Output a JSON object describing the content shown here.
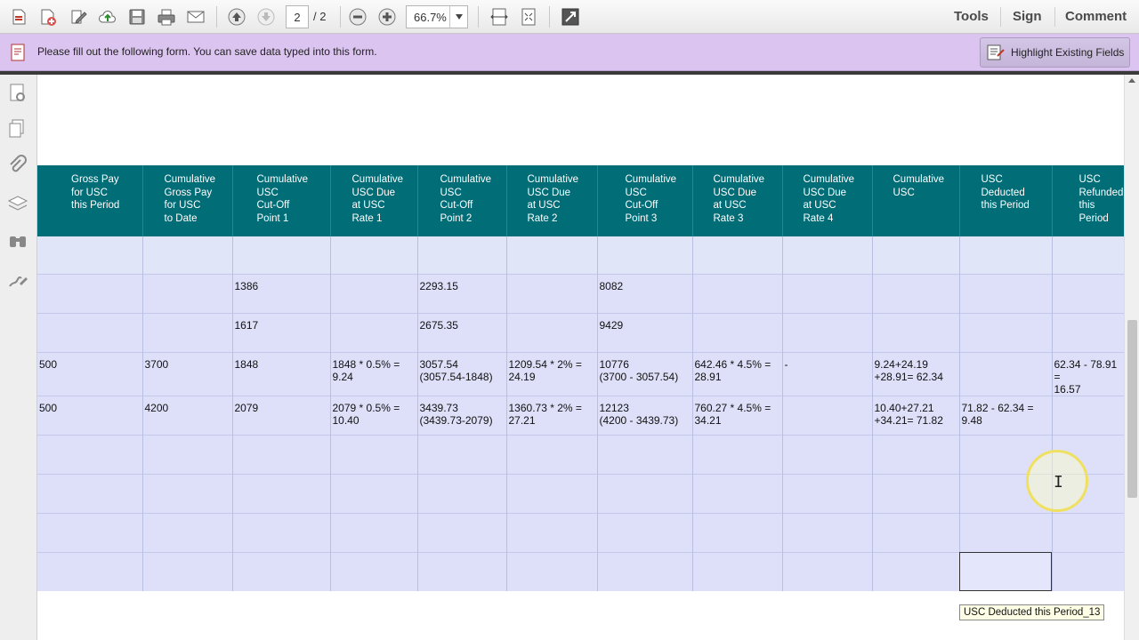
{
  "toolbar": {
    "current_page": "2",
    "total_pages": "/ 2",
    "zoom": "66.7%",
    "links": {
      "tools": "Tools",
      "sign": "Sign",
      "comment": "Comment"
    },
    "icons": [
      "create-pdf-icon",
      "add-file-icon",
      "edit-icon",
      "upload-icon",
      "save-icon",
      "print-icon",
      "email-icon",
      "page-up-icon",
      "page-down-icon",
      "zoom-out-icon",
      "zoom-in-icon",
      "fit-width-icon",
      "fit-page-icon",
      "full-screen-icon"
    ]
  },
  "form_bar": {
    "message": "Please fill out the following form. You can save data typed into this form.",
    "highlight_button": "Highlight Existing Fields"
  },
  "leftnav": {
    "icons": [
      "page-thumbnails-icon",
      "pages-icon",
      "attachments-icon",
      "layers-icon",
      "binoculars-icon",
      "signature-icon"
    ]
  },
  "table": {
    "headers": [
      "Gross Pay\nfor USC\nthis Period",
      "Cumulative\nGross Pay\nfor USC\nto Date",
      "Cumulative\nUSC\nCut-Off\nPoint 1",
      "Cumulative\nUSC Due\nat USC\nRate 1",
      "Cumulative\nUSC\nCut-Off\nPoint 2",
      "Cumulative\nUSC Due\nat USC\nRate 2",
      "Cumulative\nUSC\nCut-Off\nPoint 3",
      "Cumulative\nUSC Due\nat USC\nRate 3",
      "Cumulative\nUSC Due\nat USC\nRate 4",
      "Cumulative\nUSC",
      "USC\nDeducted\nthis Period",
      "USC\nRefunded\nthis Period"
    ],
    "rows": [
      [
        "",
        "",
        "",
        "",
        "",
        "",
        "",
        "",
        "",
        "",
        "",
        ""
      ],
      [
        "",
        "",
        "1386",
        "",
        "2293.15",
        "",
        "8082",
        "",
        "",
        "",
        "",
        ""
      ],
      [
        "",
        "",
        "1617",
        "",
        "2675.35",
        "",
        "9429",
        "",
        "",
        "",
        "",
        ""
      ],
      [
        "500",
        "3700",
        "1848",
        "1848 * 0.5% =\n9.24",
        "3057.54\n(3057.54-1848)",
        "1209.54 * 2% =\n24.19",
        "10776\n(3700 - 3057.54)",
        "642.46 * 4.5% =\n28.91",
        "-",
        "9.24+24.19\n+28.91= 62.34",
        "",
        "62.34 - 78.91 =\n16.57"
      ],
      [
        "500",
        "4200",
        "2079",
        "2079 * 0.5% =\n10.40",
        "3439.73\n(3439.73-2079)",
        "1360.73 * 2% =\n27.21",
        "12123\n(4200 - 3439.73)",
        "760.27 * 4.5% =\n34.21",
        "",
        "10.40+27.21\n+34.21= 71.82",
        "71.82 - 62.34 =\n9.48",
        ""
      ],
      [
        "",
        "",
        "",
        "",
        "",
        "",
        "",
        "",
        "",
        "",
        "",
        ""
      ],
      [
        "",
        "",
        "",
        "",
        "",
        "",
        "",
        "",
        "",
        "",
        "",
        ""
      ],
      [
        "",
        "",
        "",
        "",
        "",
        "",
        "",
        "",
        "",
        "",
        "",
        ""
      ],
      [
        "",
        "",
        "",
        "",
        "",
        "",
        "",
        "",
        "",
        "",
        "",
        ""
      ]
    ]
  },
  "tooltip": "USC Deducted this Period_13"
}
